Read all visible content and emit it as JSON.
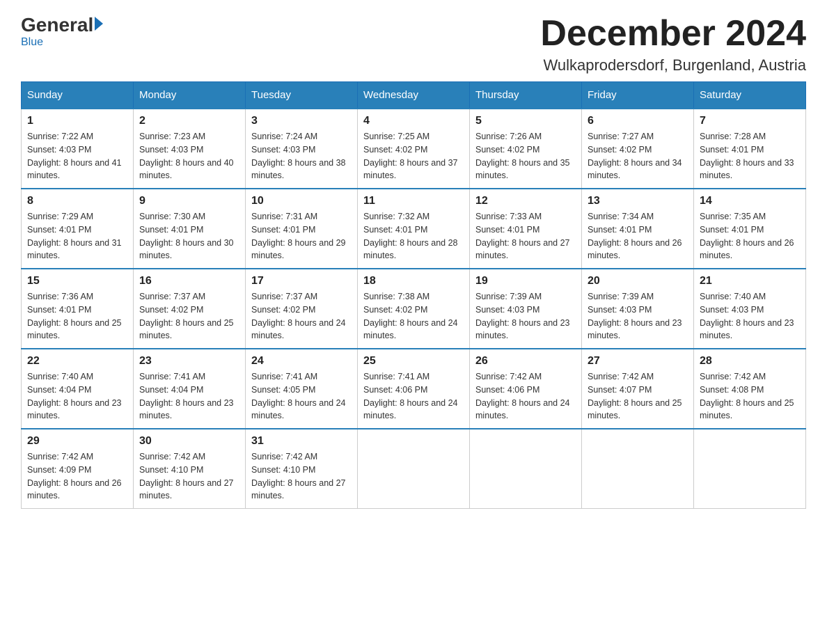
{
  "header": {
    "logo_general": "General",
    "logo_blue": "Blue",
    "month_title": "December 2024",
    "location": "Wulkaprodersdorf, Burgenland, Austria"
  },
  "weekdays": [
    "Sunday",
    "Monday",
    "Tuesday",
    "Wednesday",
    "Thursday",
    "Friday",
    "Saturday"
  ],
  "weeks": [
    [
      {
        "day": "1",
        "sunrise": "7:22 AM",
        "sunset": "4:03 PM",
        "daylight": "8 hours and 41 minutes."
      },
      {
        "day": "2",
        "sunrise": "7:23 AM",
        "sunset": "4:03 PM",
        "daylight": "8 hours and 40 minutes."
      },
      {
        "day": "3",
        "sunrise": "7:24 AM",
        "sunset": "4:03 PM",
        "daylight": "8 hours and 38 minutes."
      },
      {
        "day": "4",
        "sunrise": "7:25 AM",
        "sunset": "4:02 PM",
        "daylight": "8 hours and 37 minutes."
      },
      {
        "day": "5",
        "sunrise": "7:26 AM",
        "sunset": "4:02 PM",
        "daylight": "8 hours and 35 minutes."
      },
      {
        "day": "6",
        "sunrise": "7:27 AM",
        "sunset": "4:02 PM",
        "daylight": "8 hours and 34 minutes."
      },
      {
        "day": "7",
        "sunrise": "7:28 AM",
        "sunset": "4:01 PM",
        "daylight": "8 hours and 33 minutes."
      }
    ],
    [
      {
        "day": "8",
        "sunrise": "7:29 AM",
        "sunset": "4:01 PM",
        "daylight": "8 hours and 31 minutes."
      },
      {
        "day": "9",
        "sunrise": "7:30 AM",
        "sunset": "4:01 PM",
        "daylight": "8 hours and 30 minutes."
      },
      {
        "day": "10",
        "sunrise": "7:31 AM",
        "sunset": "4:01 PM",
        "daylight": "8 hours and 29 minutes."
      },
      {
        "day": "11",
        "sunrise": "7:32 AM",
        "sunset": "4:01 PM",
        "daylight": "8 hours and 28 minutes."
      },
      {
        "day": "12",
        "sunrise": "7:33 AM",
        "sunset": "4:01 PM",
        "daylight": "8 hours and 27 minutes."
      },
      {
        "day": "13",
        "sunrise": "7:34 AM",
        "sunset": "4:01 PM",
        "daylight": "8 hours and 26 minutes."
      },
      {
        "day": "14",
        "sunrise": "7:35 AM",
        "sunset": "4:01 PM",
        "daylight": "8 hours and 26 minutes."
      }
    ],
    [
      {
        "day": "15",
        "sunrise": "7:36 AM",
        "sunset": "4:01 PM",
        "daylight": "8 hours and 25 minutes."
      },
      {
        "day": "16",
        "sunrise": "7:37 AM",
        "sunset": "4:02 PM",
        "daylight": "8 hours and 25 minutes."
      },
      {
        "day": "17",
        "sunrise": "7:37 AM",
        "sunset": "4:02 PM",
        "daylight": "8 hours and 24 minutes."
      },
      {
        "day": "18",
        "sunrise": "7:38 AM",
        "sunset": "4:02 PM",
        "daylight": "8 hours and 24 minutes."
      },
      {
        "day": "19",
        "sunrise": "7:39 AM",
        "sunset": "4:03 PM",
        "daylight": "8 hours and 23 minutes."
      },
      {
        "day": "20",
        "sunrise": "7:39 AM",
        "sunset": "4:03 PM",
        "daylight": "8 hours and 23 minutes."
      },
      {
        "day": "21",
        "sunrise": "7:40 AM",
        "sunset": "4:03 PM",
        "daylight": "8 hours and 23 minutes."
      }
    ],
    [
      {
        "day": "22",
        "sunrise": "7:40 AM",
        "sunset": "4:04 PM",
        "daylight": "8 hours and 23 minutes."
      },
      {
        "day": "23",
        "sunrise": "7:41 AM",
        "sunset": "4:04 PM",
        "daylight": "8 hours and 23 minutes."
      },
      {
        "day": "24",
        "sunrise": "7:41 AM",
        "sunset": "4:05 PM",
        "daylight": "8 hours and 24 minutes."
      },
      {
        "day": "25",
        "sunrise": "7:41 AM",
        "sunset": "4:06 PM",
        "daylight": "8 hours and 24 minutes."
      },
      {
        "day": "26",
        "sunrise": "7:42 AM",
        "sunset": "4:06 PM",
        "daylight": "8 hours and 24 minutes."
      },
      {
        "day": "27",
        "sunrise": "7:42 AM",
        "sunset": "4:07 PM",
        "daylight": "8 hours and 25 minutes."
      },
      {
        "day": "28",
        "sunrise": "7:42 AM",
        "sunset": "4:08 PM",
        "daylight": "8 hours and 25 minutes."
      }
    ],
    [
      {
        "day": "29",
        "sunrise": "7:42 AM",
        "sunset": "4:09 PM",
        "daylight": "8 hours and 26 minutes."
      },
      {
        "day": "30",
        "sunrise": "7:42 AM",
        "sunset": "4:10 PM",
        "daylight": "8 hours and 27 minutes."
      },
      {
        "day": "31",
        "sunrise": "7:42 AM",
        "sunset": "4:10 PM",
        "daylight": "8 hours and 27 minutes."
      },
      null,
      null,
      null,
      null
    ]
  ]
}
